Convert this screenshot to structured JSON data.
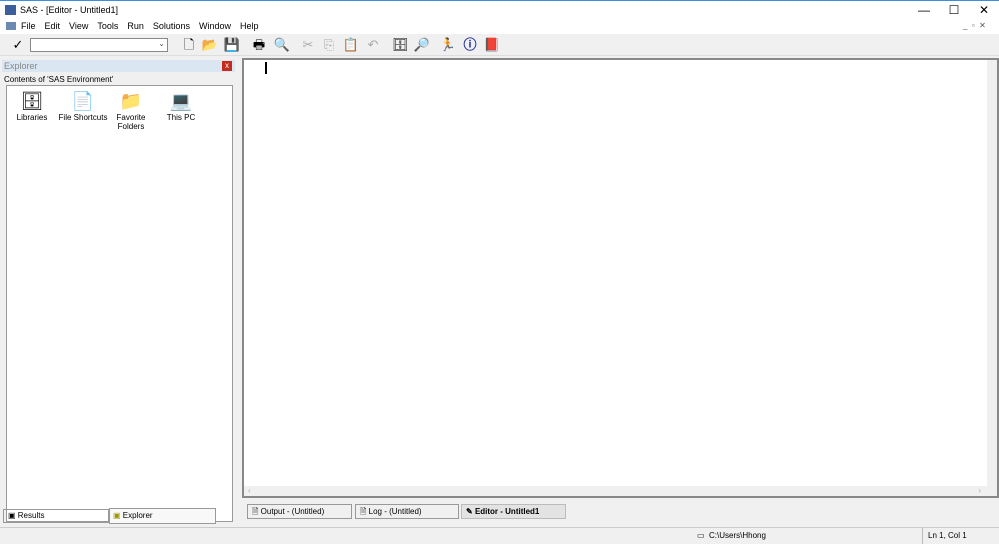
{
  "window": {
    "title": "SAS - [Editor - Untitled1]",
    "minimize": "—",
    "maximize": "☐",
    "close": "✕"
  },
  "menu": [
    "File",
    "Edit",
    "View",
    "Tools",
    "Run",
    "Solutions",
    "Window",
    "Help"
  ],
  "toolbar": {
    "submit_check": "✓",
    "command_value": "",
    "icons": [
      "new-icon",
      "open-icon",
      "save-icon",
      "print-icon",
      "print-preview-icon",
      "cut-icon",
      "copy-icon",
      "paste-icon",
      "undo-icon",
      "new-library-icon",
      "explorer-icon",
      "run-icon",
      "break-icon",
      "help-icon"
    ]
  },
  "explorer": {
    "title": "Explorer",
    "close": "x",
    "contents_label": "Contents of 'SAS Environment'",
    "items": [
      {
        "label": "Libraries",
        "glyph": "🗄"
      },
      {
        "label": "File Shortcuts",
        "glyph": "📄"
      },
      {
        "label": "Favorite Folders",
        "glyph": "📁"
      },
      {
        "label": "This PC",
        "glyph": "💻"
      }
    ]
  },
  "left_tabs": [
    "Results",
    "Explorer"
  ],
  "window_tabs": [
    "Output - (Untitled)",
    "Log - (Untitled)",
    "Editor - Untitled1"
  ],
  "status": {
    "path": "C:\\Users\\Hhong",
    "position": "Ln 1, Col 1"
  }
}
